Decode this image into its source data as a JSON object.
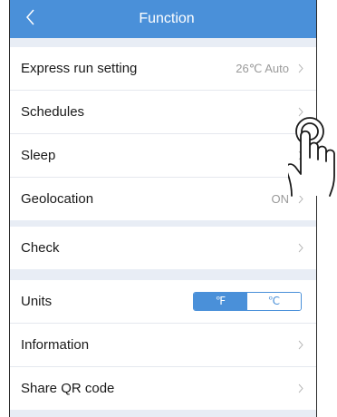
{
  "header": {
    "title": "Function"
  },
  "rows": [
    {
      "label": "Express run setting",
      "value": "26℃ Auto"
    },
    {
      "label": "Schedules"
    },
    {
      "label": "Sleep"
    },
    {
      "label": "Geolocation",
      "value": "ON"
    },
    {
      "label": "Check"
    },
    {
      "label": "Units",
      "options": [
        "℉",
        "℃"
      ],
      "selected": "℉"
    },
    {
      "label": "Information"
    },
    {
      "label": "Share QR code"
    }
  ],
  "colors": {
    "accent": "#4a90d9",
    "background": "#e8edf5"
  },
  "icons": [
    "back-arrow-icon",
    "chevron-right-icon",
    "tap-hand-icon"
  ]
}
